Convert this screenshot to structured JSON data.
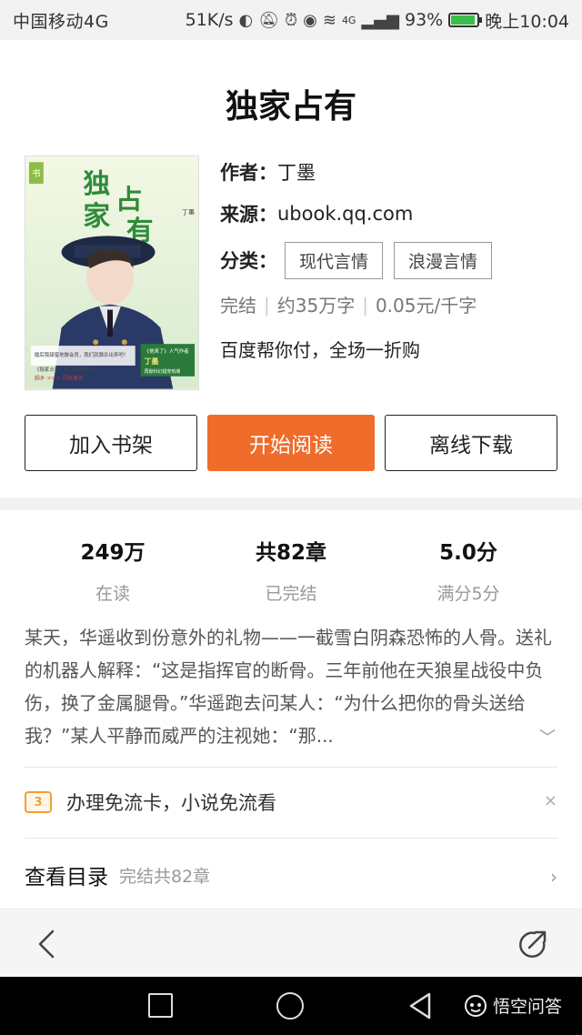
{
  "status_bar": {
    "carrier": "中国移动4G",
    "net_speed": "51K/s",
    "signal_label": "4G",
    "battery": "93%",
    "time": "晚上10:04"
  },
  "book": {
    "title": "独家占有",
    "author_label": "作者：",
    "author": "丁墨",
    "source_label": "来源：",
    "source": "ubook.qq.com",
    "category_label": "分类：",
    "tags": [
      "现代言情",
      "浪漫言情"
    ],
    "status": "完结",
    "word_count": "约35万字",
    "price": "0.05元/千字",
    "promo": "百度帮你付，全场一折购"
  },
  "cover": {
    "title_chars": [
      "独",
      "家",
      "占",
      "有"
    ],
    "badge": "书",
    "author_small": "丁墨",
    "blurb_1": "婚后我甜蜜地做会员，我们就厮杀出来吧！",
    "blurb_2": "《独家占有》第二部期待中",
    "blurb_3": "超乡 >>> 顶级番外",
    "side_1": "《他来了》人气作者",
    "side_2": "丁墨",
    "side_3": "再掀科幻甜宠热潮"
  },
  "actions": {
    "add_shelf": "加入书架",
    "start_read": "开始阅读",
    "offline": "离线下载"
  },
  "stats": [
    {
      "value": "249万",
      "label": "在读"
    },
    {
      "value": "共82章",
      "label": "已完结"
    },
    {
      "value": "5.0分",
      "label": "满分5分"
    }
  ],
  "synopsis": "某天，华遥收到份意外的礼物——一截雪白阴森恐怖的人骨。送礼的机器人解释：“这是指挥官的断骨。三年前他在天狼星战役中负伤，换了金属腿骨。”华遥跑去问某人：“为什么把你的骨头送给我？”某人平静而威严的注视她：“那...",
  "flow_card": {
    "icon_text": "3",
    "text": "办理免流卡，小说免流看",
    "close": "×"
  },
  "toc": {
    "title": "查看目录",
    "sub": "完结共82章",
    "chevron": "›"
  },
  "watermark": "悟空问答",
  "icons": {
    "back": "back-arrow-icon",
    "share": "share-icon",
    "expand": "chevron-down-icon"
  },
  "colors": {
    "accent": "#f06c2a",
    "flow_icon": "#f0a132"
  }
}
